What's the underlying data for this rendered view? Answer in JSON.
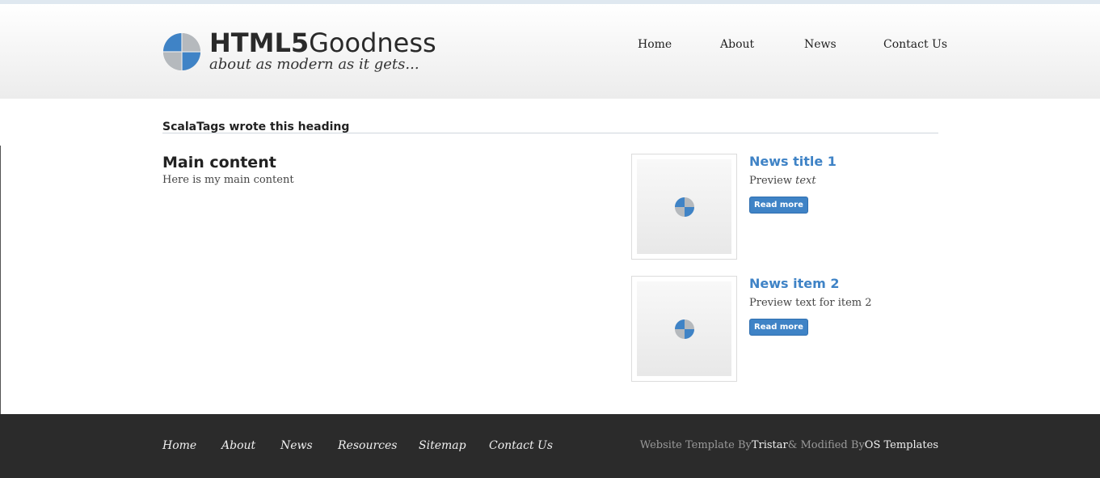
{
  "header": {
    "title_bold": "HTML5",
    "title_rest": "Goodness",
    "tagline": "about as modern as it gets...",
    "logo_icon": "quartered-circle-logo-icon",
    "nav": [
      {
        "label": "Home"
      },
      {
        "label": "About"
      },
      {
        "label": "News"
      },
      {
        "label": "Contact Us"
      }
    ]
  },
  "main": {
    "section_heading": "ScalaTags wrote this heading",
    "title": "Main content",
    "text": "Here is my main content"
  },
  "news": [
    {
      "title": "News title 1",
      "preview_plain": "Preview ",
      "preview_italic": "text",
      "read_more": "Read more"
    },
    {
      "title": "News item 2",
      "preview_plain": "Preview text for item 2",
      "preview_italic": "",
      "read_more": "Read more"
    }
  ],
  "footer": {
    "nav": [
      {
        "label": "Home"
      },
      {
        "label": "About"
      },
      {
        "label": "News"
      },
      {
        "label": "Resources"
      },
      {
        "label": "Sitemap"
      },
      {
        "label": "Contact Us"
      }
    ],
    "credit_prefix": "Website Template By",
    "credit_author": "Tristar",
    "credit_middle": "& Modified By",
    "credit_modifier": "OS Templates"
  },
  "colors": {
    "accent": "#3f83c6",
    "footer_bg": "#2b2b2b"
  }
}
